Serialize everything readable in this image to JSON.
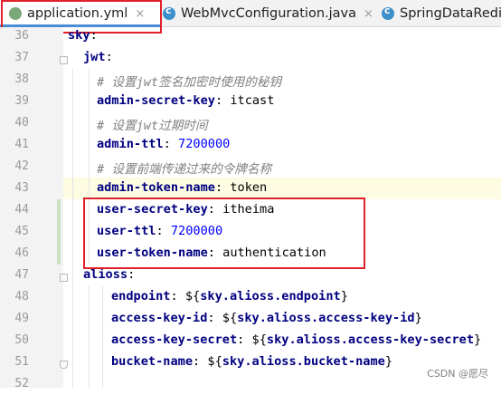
{
  "tabs": [
    {
      "label": "application.yml",
      "icon": "yml-file-icon",
      "closable": true,
      "active": true
    },
    {
      "label": "WebMvcConfiguration.java",
      "icon": "java-class-icon",
      "closable": true,
      "active": false
    },
    {
      "label": "SpringDataRedis",
      "icon": "java-class-icon",
      "closable": false,
      "active": false
    }
  ],
  "tab_close_glyph": "×",
  "lines": [
    {
      "num": "36",
      "parts": [
        {
          "t": "sky",
          "c": "k"
        },
        {
          "t": ":",
          "c": "p"
        }
      ]
    },
    {
      "num": "37",
      "parts": [
        {
          "t": "jwt",
          "c": "k"
        },
        {
          "t": ":",
          "c": "p"
        }
      ]
    },
    {
      "num": "38",
      "parts": [
        {
          "t": "# 设置jwt签名加密时使用的秘钥",
          "c": "cm"
        }
      ]
    },
    {
      "num": "39",
      "parts": [
        {
          "t": "admin-secret-key",
          "c": "k"
        },
        {
          "t": ": itcast",
          "c": "p"
        }
      ]
    },
    {
      "num": "40",
      "parts": [
        {
          "t": "# 设置jwt过期时间",
          "c": "cm"
        }
      ]
    },
    {
      "num": "41",
      "parts": [
        {
          "t": "admin-ttl",
          "c": "k"
        },
        {
          "t": ": ",
          "c": "p"
        },
        {
          "t": "7200000",
          "c": "num"
        }
      ]
    },
    {
      "num": "42",
      "parts": [
        {
          "t": "# 设置前端传递过来的令牌名称",
          "c": "cm"
        }
      ]
    },
    {
      "num": "43",
      "parts": [
        {
          "t": "admin-token-name",
          "c": "k"
        },
        {
          "t": ": token",
          "c": "p"
        }
      ]
    },
    {
      "num": "44",
      "parts": [
        {
          "t": "user-secret-key",
          "c": "k"
        },
        {
          "t": ": itheima",
          "c": "p"
        }
      ]
    },
    {
      "num": "45",
      "parts": [
        {
          "t": "user-ttl",
          "c": "k"
        },
        {
          "t": ": ",
          "c": "p"
        },
        {
          "t": "7200000",
          "c": "num"
        }
      ]
    },
    {
      "num": "46",
      "parts": [
        {
          "t": "user-token-name",
          "c": "k"
        },
        {
          "t": ": authentication",
          "c": "p"
        }
      ]
    },
    {
      "num": "47",
      "parts": [
        {
          "t": "alioss",
          "c": "k"
        },
        {
          "t": ":",
          "c": "p"
        }
      ]
    },
    {
      "num": "48",
      "parts": [
        {
          "t": "endpoint",
          "c": "k"
        },
        {
          "t": ": ${",
          "c": "p"
        },
        {
          "t": "sky.alioss.endpoint",
          "c": "ex"
        },
        {
          "t": "}",
          "c": "p"
        }
      ]
    },
    {
      "num": "49",
      "parts": [
        {
          "t": "access-key-id",
          "c": "k"
        },
        {
          "t": ": ${",
          "c": "p"
        },
        {
          "t": "sky.alioss.access-key-id",
          "c": "ex"
        },
        {
          "t": "}",
          "c": "p"
        }
      ]
    },
    {
      "num": "50",
      "parts": [
        {
          "t": "access-key-secret",
          "c": "k"
        },
        {
          "t": ": ${",
          "c": "p"
        },
        {
          "t": "sky.alioss.access-key-secret",
          "c": "ex"
        },
        {
          "t": "}",
          "c": "p"
        }
      ]
    },
    {
      "num": "51",
      "parts": [
        {
          "t": "bucket-name",
          "c": "k"
        },
        {
          "t": ": ${",
          "c": "p"
        },
        {
          "t": "sky.alioss.bucket-name",
          "c": "ex"
        },
        {
          "t": "}",
          "c": "p"
        }
      ]
    },
    {
      "num": "52",
      "parts": []
    }
  ],
  "watermark": "CSDN @愿尽",
  "colors": {
    "key": "#000080",
    "comment": "#808080",
    "number": "#0000ff",
    "annotation_box": "#e0202a",
    "current_line": "#fdfce3"
  }
}
